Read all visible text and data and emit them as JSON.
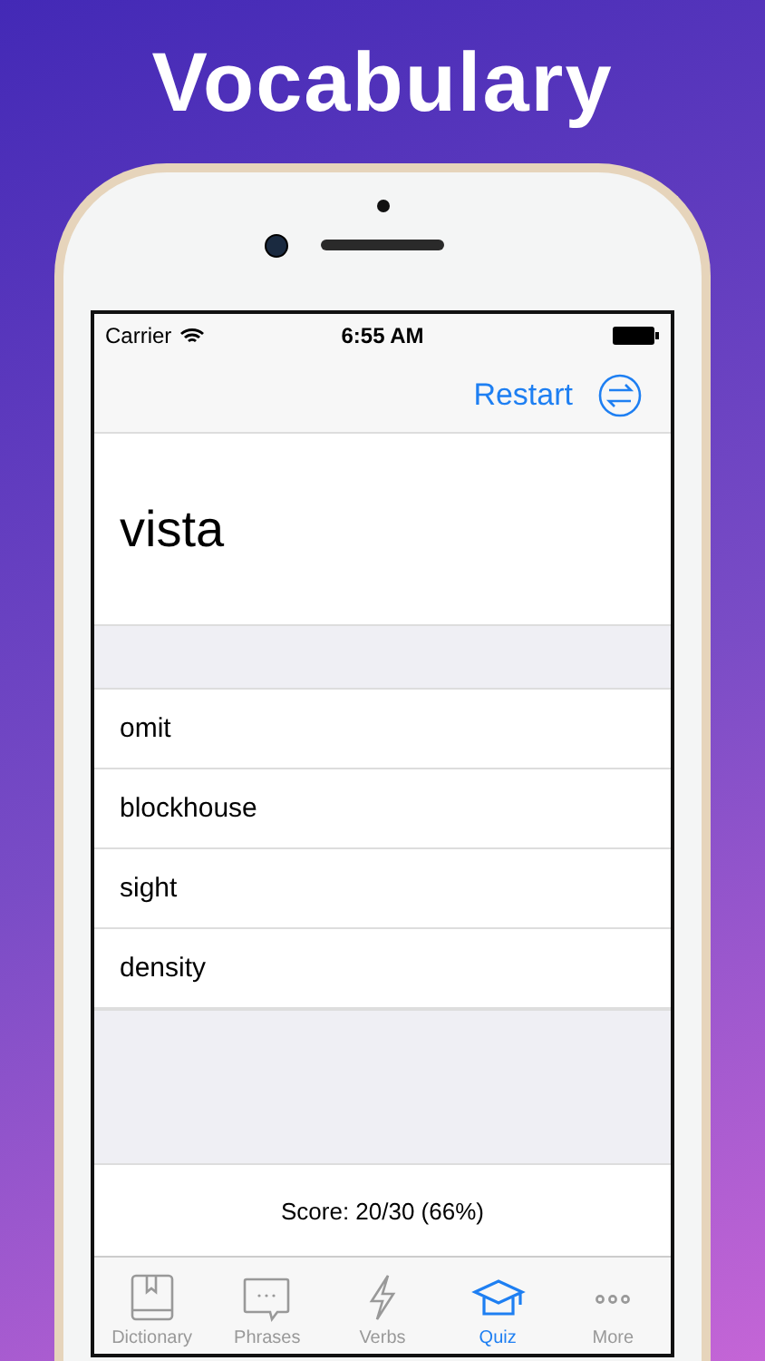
{
  "headline": "Vocabulary",
  "status_bar": {
    "carrier": "Carrier",
    "time": "6:55 AM"
  },
  "nav": {
    "action": "Restart"
  },
  "word": "vista",
  "options": [
    "omit",
    "blockhouse",
    "sight",
    "density"
  ],
  "score": "Score: 20/30 (66%)",
  "tabs": [
    {
      "label": "Dictionary",
      "selected": false
    },
    {
      "label": "Phrases",
      "selected": false
    },
    {
      "label": "Verbs",
      "selected": false
    },
    {
      "label": "Quiz",
      "selected": true
    },
    {
      "label": "More",
      "selected": false
    }
  ]
}
